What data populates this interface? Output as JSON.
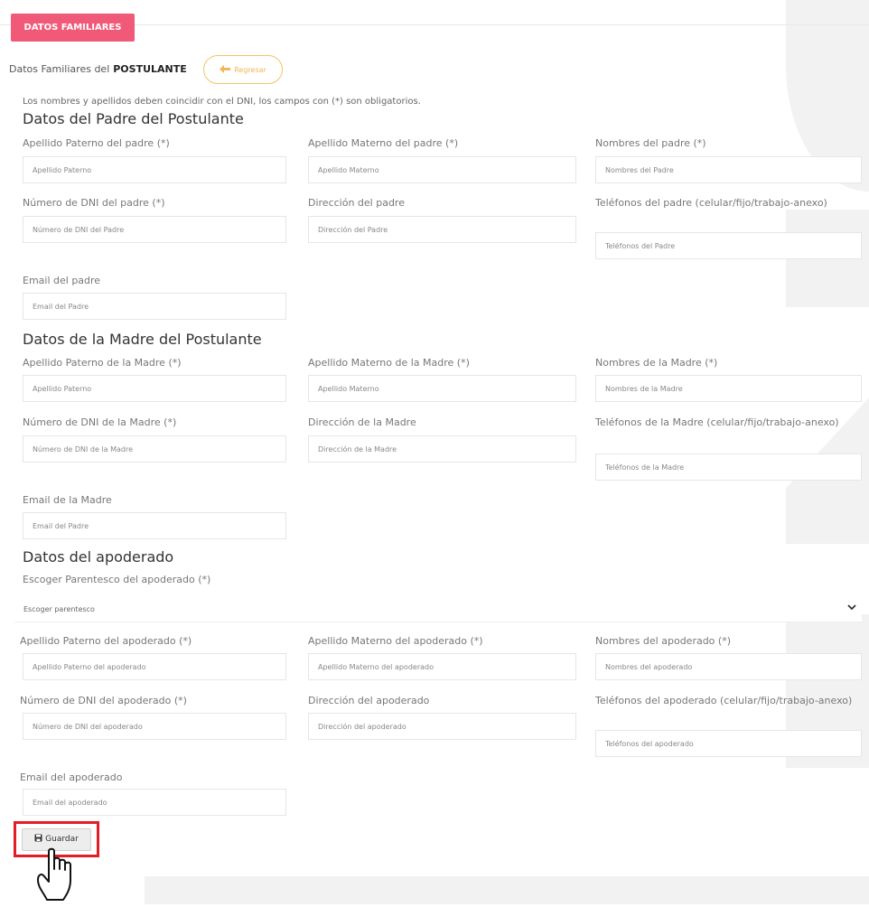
{
  "tab": "DATOS FAMILIARES",
  "heading": {
    "prefix": "Datos Familiares del",
    "bold": "POSTULANTE",
    "back": "Regresar"
  },
  "note": "Los nombres y apellidos deben coincidir con el DNI, los campos con (*) son obligatorios.",
  "padre": {
    "title": "Datos del Padre del Postulante",
    "ap_paterno": {
      "label": "Apellido Paterno del padre (*)",
      "placeholder": "Apellido Paterno"
    },
    "ap_materno": {
      "label": "Apellido Materno del padre (*)",
      "placeholder": "Apellido Materno"
    },
    "nombres": {
      "label": "Nombres del padre (*)",
      "placeholder": "Nombres del Padre"
    },
    "dni": {
      "label": "Número de DNI del padre (*)",
      "placeholder": "Número de DNI del Padre"
    },
    "direccion": {
      "label": "Dirección del padre",
      "placeholder": "Dirección del Padre"
    },
    "telefonos": {
      "label": "Teléfonos del padre (celular/fijo/trabajo-anexo)",
      "placeholder": "Teléfonos del Padre"
    },
    "email": {
      "label": "Email del padre",
      "placeholder": "Email del Padre"
    }
  },
  "madre": {
    "title": "Datos de la Madre del Postulante",
    "ap_paterno": {
      "label": "Apellido Paterno de la Madre (*)",
      "placeholder": "Apellido Paterno"
    },
    "ap_materno": {
      "label": "Apellido Materno de la Madre (*)",
      "placeholder": "Apellido Materno"
    },
    "nombres": {
      "label": "Nombres de la Madre (*)",
      "placeholder": "Nombres de la Madre"
    },
    "dni": {
      "label": "Número de DNI de la Madre (*)",
      "placeholder": "Número de DNI de la Madre"
    },
    "direccion": {
      "label": "Dirección de la Madre",
      "placeholder": "Dirección de la Madre"
    },
    "telefonos": {
      "label": "Teléfonos de la Madre (celular/fijo/trabajo-anexo)",
      "placeholder": "Teléfonos de la Madre"
    },
    "email": {
      "label": "Email de la Madre",
      "placeholder": "Email del Padre"
    }
  },
  "apoderado": {
    "title": "Datos del apoderado",
    "parentesco": {
      "label": "Escoger Parentesco del apoderado (*)",
      "value": "Escoger parentesco"
    },
    "ap_paterno": {
      "label": "Apellido Paterno del apoderado (*)",
      "placeholder": "Apellido Paterno del apoderado"
    },
    "ap_materno": {
      "label": "Apellido Materno del apoderado (*)",
      "placeholder": "Apellido Materno del apoderado"
    },
    "nombres": {
      "label": "Nombres del apoderado (*)",
      "placeholder": "Nombres del apoderado"
    },
    "dni": {
      "label": "Número de DNI del apoderado (*)",
      "placeholder": "Número de DNI del apoderado"
    },
    "direccion": {
      "label": "Dirección del apoderado",
      "placeholder": "Dirección del apoderado"
    },
    "telefonos": {
      "label": "Teléfonos del apoderado (celular/fijo/trabajo-anexo)",
      "placeholder": "Teléfonos del apoderado"
    },
    "email": {
      "label": "Email del apoderado",
      "placeholder": "Email del apoderado"
    }
  },
  "save": "Guardar",
  "colors": {
    "tab": "#f05a78",
    "back_border": "#f6c16a",
    "highlight": "#e21d25"
  },
  "icons": [
    "arrow-left-icon",
    "save-icon",
    "hand-pointer-icon",
    "chevron-down-icon"
  ]
}
